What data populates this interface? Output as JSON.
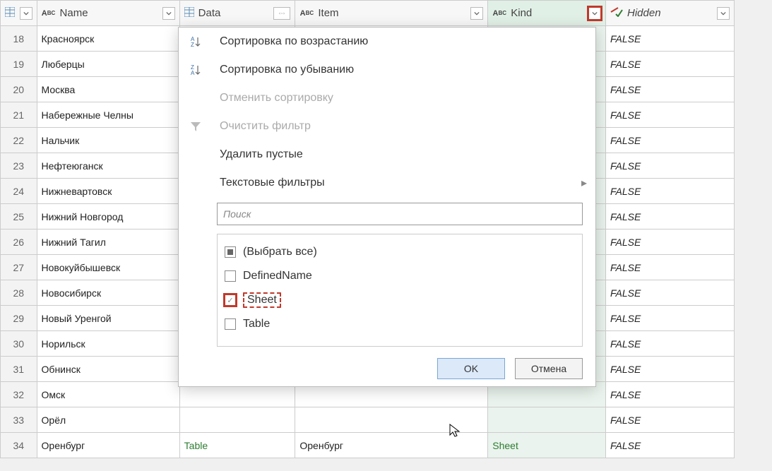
{
  "columns": {
    "name": "Name",
    "data": "Data",
    "item": "Item",
    "kind": "Kind",
    "hidden": "Hidden"
  },
  "rows": [
    {
      "num": "18",
      "name": "Красноярск",
      "data": "",
      "item": "",
      "kind": "",
      "hidden": "FALSE"
    },
    {
      "num": "19",
      "name": "Люберцы",
      "data": "",
      "item": "",
      "kind": "",
      "hidden": "FALSE"
    },
    {
      "num": "20",
      "name": "Москва",
      "data": "",
      "item": "",
      "kind": "",
      "hidden": "FALSE"
    },
    {
      "num": "21",
      "name": "Набережные Челны",
      "data": "",
      "item": "",
      "kind": "",
      "hidden": "FALSE"
    },
    {
      "num": "22",
      "name": "Нальчик",
      "data": "",
      "item": "",
      "kind": "",
      "hidden": "FALSE"
    },
    {
      "num": "23",
      "name": "Нефтеюганск",
      "data": "",
      "item": "",
      "kind": "",
      "hidden": "FALSE"
    },
    {
      "num": "24",
      "name": "Нижневартовск",
      "data": "",
      "item": "",
      "kind": "",
      "hidden": "FALSE"
    },
    {
      "num": "25",
      "name": "Нижний Новгород",
      "data": "",
      "item": "",
      "kind": "",
      "hidden": "FALSE"
    },
    {
      "num": "26",
      "name": "Нижний Тагил",
      "data": "",
      "item": "",
      "kind": "",
      "hidden": "FALSE"
    },
    {
      "num": "27",
      "name": "Новокуйбышевск",
      "data": "",
      "item": "",
      "kind": "",
      "hidden": "FALSE"
    },
    {
      "num": "28",
      "name": "Новосибирск",
      "data": "",
      "item": "",
      "kind": "",
      "hidden": "FALSE"
    },
    {
      "num": "29",
      "name": "Новый Уренгой",
      "data": "",
      "item": "",
      "kind": "",
      "hidden": "FALSE"
    },
    {
      "num": "30",
      "name": "Норильск",
      "data": "",
      "item": "",
      "kind": "",
      "hidden": "FALSE"
    },
    {
      "num": "31",
      "name": "Обнинск",
      "data": "",
      "item": "",
      "kind": "",
      "hidden": "FALSE"
    },
    {
      "num": "32",
      "name": "Омск",
      "data": "",
      "item": "",
      "kind": "",
      "hidden": "FALSE"
    },
    {
      "num": "33",
      "name": "Орёл",
      "data": "",
      "item": "",
      "kind": "",
      "hidden": "FALSE"
    },
    {
      "num": "34",
      "name": "Оренбург",
      "data": "Table",
      "item": "Оренбург",
      "kind": "Sheet",
      "hidden": "FALSE"
    }
  ],
  "menu": {
    "sort_asc": "Сортировка по возрастанию",
    "sort_desc": "Сортировка по убыванию",
    "clear_sort": "Отменить сортировку",
    "clear_filter": "Очистить фильтр",
    "remove_empty": "Удалить пустые",
    "text_filters": "Текстовые фильтры"
  },
  "search": {
    "placeholder": "Поиск"
  },
  "filter_options": {
    "select_all": "(Выбрать все)",
    "opt1": "DefinedName",
    "opt2": "Sheet",
    "opt3": "Table"
  },
  "buttons": {
    "ok": "OK",
    "cancel": "Отмена"
  }
}
